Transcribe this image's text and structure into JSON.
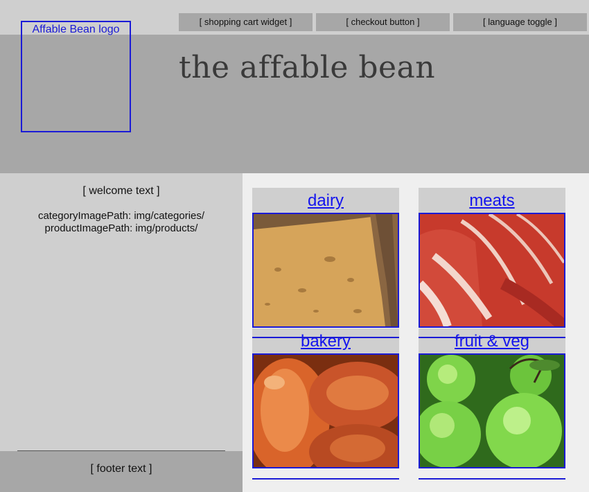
{
  "header": {
    "logo_text": "Affable Bean logo",
    "title": "the affable bean",
    "widgets": {
      "cart": "[ shopping cart widget ]",
      "checkout": "[ checkout button ]",
      "language": "[ language toggle ]"
    }
  },
  "sidebar": {
    "welcome": "[ welcome text ]",
    "category_image_path": "categoryImagePath: img/categories/",
    "product_image_path": "productImagePath: img/products/"
  },
  "categories": [
    {
      "label": "dairy",
      "image": "cheese-image"
    },
    {
      "label": "meats",
      "image": "prosciutto-image"
    },
    {
      "label": "bakery",
      "image": "bread-image"
    },
    {
      "label": "fruit & veg",
      "image": "green-apples-image"
    }
  ],
  "footer": {
    "text": "[ footer text ]"
  },
  "colors": {
    "header_bg": "#a7a7a7",
    "light_bg": "#cfcfcf",
    "content_bg": "#efefef",
    "link": "#1414ee",
    "border": "#1a1ad6"
  }
}
